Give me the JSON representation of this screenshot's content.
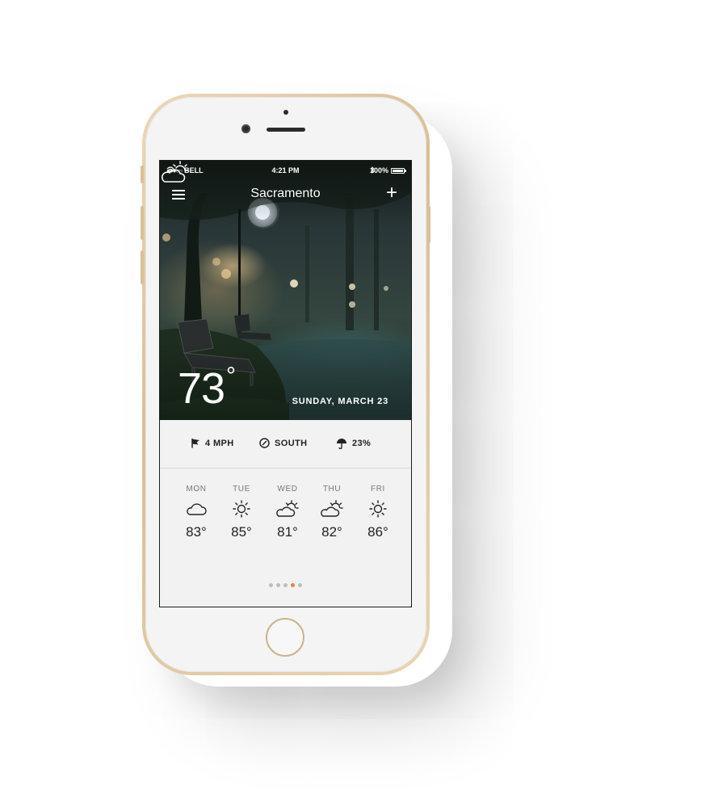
{
  "status_bar": {
    "signal": "●●●○○",
    "carrier": "BELL",
    "time": "4:21 PM",
    "battery": "100%"
  },
  "header": {
    "city": "Sacramento"
  },
  "current": {
    "temperature": "73",
    "degree_symbol": "°",
    "icon": "partly-cloudy-icon",
    "date": "SUNDAY, MARCH 23"
  },
  "conditions": {
    "wind_speed": "4 MPH",
    "wind_direction": "SOUTH",
    "precipitation": "23%"
  },
  "forecast": [
    {
      "day": "MON",
      "icon": "cloud-icon",
      "temp": "83°"
    },
    {
      "day": "TUE",
      "icon": "sun-icon",
      "temp": "85°"
    },
    {
      "day": "WED",
      "icon": "partly-cloudy-icon",
      "temp": "81°"
    },
    {
      "day": "THU",
      "icon": "partly-cloudy-icon",
      "temp": "82°"
    },
    {
      "day": "FRI",
      "icon": "sun-icon",
      "temp": "86°"
    }
  ],
  "pager": {
    "active_page": 4,
    "page_count": 5
  },
  "colors": {
    "accent": "#e8823a",
    "phone_gold": "#d9bf98",
    "panel": "#f2f2f2"
  }
}
